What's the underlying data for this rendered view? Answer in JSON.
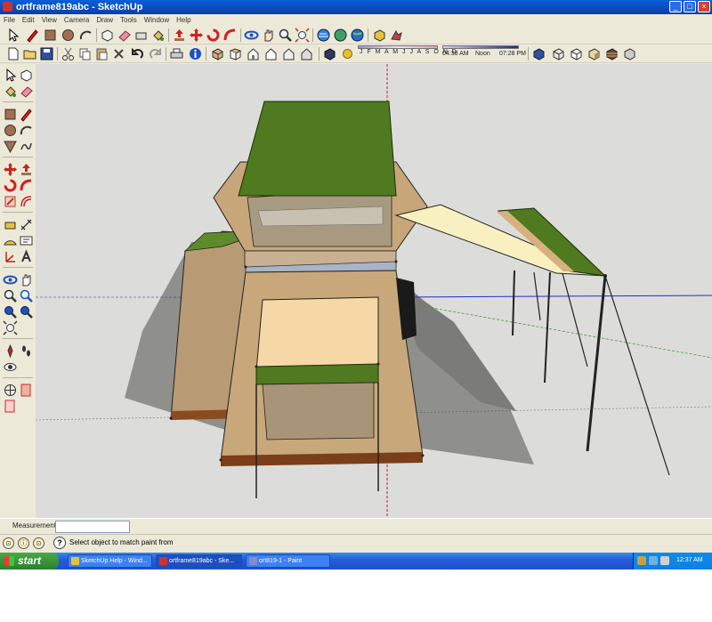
{
  "window": {
    "title": "ortframe819abc - SketchUp",
    "controls": {
      "minimize": "_",
      "maximize": "□",
      "close": "×"
    }
  },
  "menu": [
    "File",
    "Edit",
    "View",
    "Camera",
    "Draw",
    "Tools",
    "Window",
    "Help"
  ],
  "toolbar": {
    "shadow_months": "J F M A M J J A S O N D",
    "time_start": "04:38 AM",
    "time_noon": "Noon",
    "time_end": "07:28 PM"
  },
  "measurements": {
    "label": "Measurements",
    "value": ""
  },
  "status": {
    "message": "Select object to match paint from",
    "help_icon": "?"
  },
  "taskbar": {
    "start_label": "start",
    "tasks": [
      {
        "label": "SketchUp Help - Wind...",
        "active": false
      },
      {
        "label": "ortframe819abc - Ske...",
        "active": true
      },
      {
        "label": "ort819-1 - Paint",
        "active": false
      }
    ],
    "clock": "12:37 AM"
  },
  "colors": {
    "canopy_green": "#4f7a1f",
    "tent_tan": "#c8a87a",
    "awning_cream": "#f8f0c0",
    "viewport_bg": "#dcdcda",
    "xp_blue": "#245edb"
  }
}
